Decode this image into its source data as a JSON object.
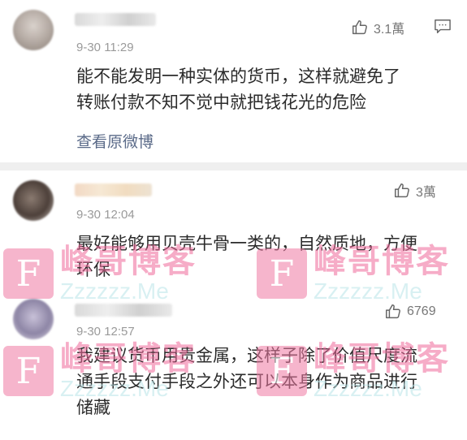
{
  "comments": [
    {
      "time": "9-30 11:29",
      "likes": "3.1萬",
      "text_lines": [
        "能不能发明一种实体的货币，这样就避免了",
        "转账付款不知不觉中就把钱花光的危险"
      ],
      "view_original": "查看原微博"
    },
    {
      "time": "9-30 12:04",
      "likes": "3萬",
      "text_lines": [
        "最好能够用贝壳牛骨一类的，自然质地，方便",
        "环保"
      ]
    },
    {
      "time": "9-30 12:57",
      "likes": "6769",
      "text_lines": [
        "我建议货币用贵金属，这样子除了价值尺度流",
        "通手段支付手段之外还可以本身作为商品进行",
        "储藏"
      ]
    }
  ],
  "watermark": {
    "logo_letter": "F",
    "cn": "峰哥博客",
    "en": "Zzzzzz.Me",
    "colors": {
      "logo_bg": "#f07aa3",
      "cn": "#f06a9a",
      "en": "#b9e5e8"
    }
  },
  "icons": {
    "like": "thumbs-up-icon",
    "reply": "comment-bubble-icon"
  }
}
